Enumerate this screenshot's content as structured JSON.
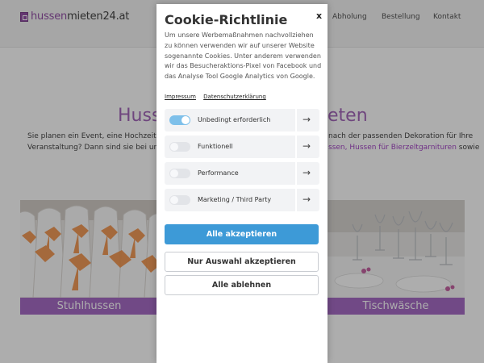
{
  "site": {
    "logo": {
      "prefix": "hussen",
      "suffix": "mieten24.at"
    },
    "nav": [
      "Abholung",
      "Bestellung",
      "Kontakt"
    ],
    "hero": {
      "title_left": "Huss",
      "title_right": "eten",
      "line1_left": "Sie planen ein Event, eine Hochzeit ode",
      "line1_right": "nach der passenden Dekoration für Ihre",
      "line2_left": "Veranstaltung? Dann sind sie bei uns ge",
      "line2_link1": "ssen,",
      "line2_link2": "Hussen für Bierzeltgarnituren",
      "line2_tail": "sowie"
    },
    "tiles": [
      {
        "caption": "Stuhlhussen"
      },
      {
        "caption": "Tischwäsche"
      }
    ]
  },
  "cookie": {
    "title": "Cookie-Richtlinie",
    "close": "x",
    "description": "Um unsere Werbemaßnahmen nachvollziehen zu können verwenden wir auf unserer Website sogenannte Cookies. Unter anderem verwenden wir das Besucheraktions-Pixel von Facebook und das Analyse Tool Google Analytics von Google.",
    "links": {
      "imprint": "Impressum",
      "privacy": "Datenschutzerklärung"
    },
    "categories": [
      {
        "label": "Unbedingt erforderlich",
        "enabled": true
      },
      {
        "label": "Funktionell",
        "enabled": false
      },
      {
        "label": "Performance",
        "enabled": false
      },
      {
        "label": "Marketing / Third Party",
        "enabled": false
      }
    ],
    "arrow_icon": "→",
    "buttons": {
      "accept_all": "Alle akzeptieren",
      "accept_selection": "Nur Auswahl akzeptieren",
      "reject_all": "Alle ablehnen"
    }
  }
}
